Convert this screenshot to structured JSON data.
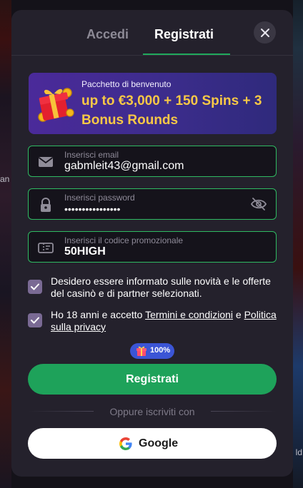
{
  "background": {
    "left_text": "an",
    "right_text": "ld"
  },
  "tabs": {
    "login_label": "Accedi",
    "register_label": "Registrati",
    "active": "Registrati"
  },
  "banner": {
    "subtitle": "Pacchetto di benvenuto",
    "headline": "up to €3,000 + 150 Spins + 3 Bonus Rounds"
  },
  "form": {
    "email": {
      "label": "Inserisci email",
      "value": "gabmleit43@gmail.com",
      "icon": "mail-icon"
    },
    "password": {
      "label": "Inserisci password",
      "value": "••••••••••••••••",
      "icon": "lock-icon",
      "toggle_icon": "eye-off-icon"
    },
    "promo": {
      "label": "Inserisci il codice promozionale",
      "value": "50HIGH",
      "icon": "ticket-icon"
    }
  },
  "checkboxes": {
    "newsletter": {
      "checked": true,
      "text": "Desidero essere informato sulle novità e le offerte del casinò e di partner selezionati."
    },
    "terms": {
      "checked": true,
      "text_before": "Ho 18 anni e accetto ",
      "terms_link": "Termini e condizioni",
      "text_middle": " e ",
      "privacy_link": "Politica sulla privacy"
    }
  },
  "badge": {
    "text": "100%",
    "icon": "gift-icon"
  },
  "buttons": {
    "register_label": "Registrati",
    "divider_text": "Oppure iscriviti con",
    "google_label": "Google"
  },
  "colors": {
    "accent_green": "#1ea25a",
    "field_border": "#2fba62",
    "banner_gold": "#f8c846",
    "badge_blue": "#3b55d6"
  }
}
